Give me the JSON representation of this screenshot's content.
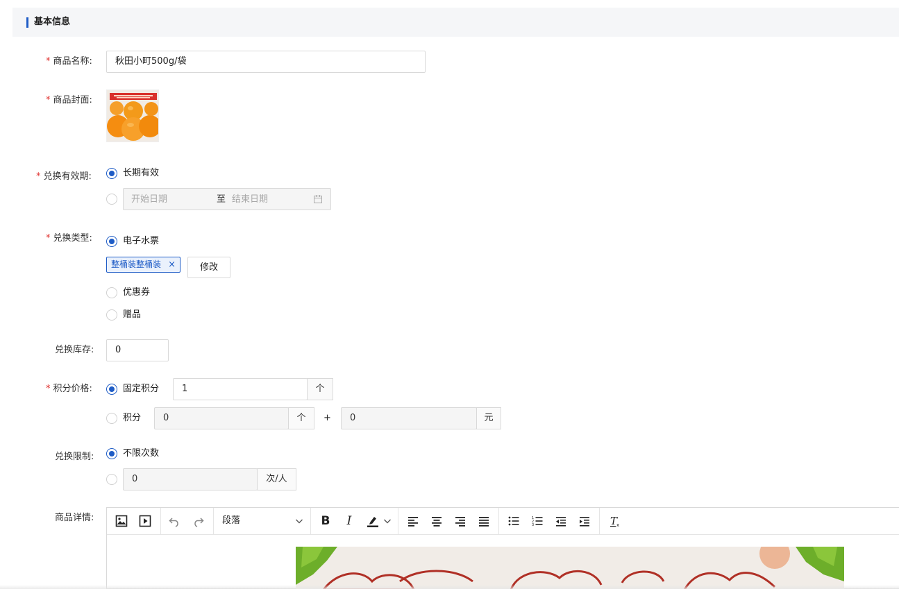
{
  "section": {
    "title": "基本信息"
  },
  "form": {
    "name": {
      "label": "商品名称:",
      "value": "秋田小町500g/袋"
    },
    "cover": {
      "label": "商品封面:",
      "banner_text": "秋田小町500g/袋 柑橘鲜果"
    },
    "validity": {
      "label": "兑换有效期:",
      "option_long": "长期有效",
      "start_placeholder": "开始日期",
      "separator": "至",
      "end_placeholder": "结束日期"
    },
    "type": {
      "label": "兑换类型:",
      "option_ticket": "电子水票",
      "tag": "整桶装整桶装",
      "tag_close": "×",
      "modify_button": "修改",
      "option_coupon": "优惠券",
      "option_gift": "赠品"
    },
    "stock": {
      "label": "兑换库存:",
      "value": "0"
    },
    "price": {
      "label": "积分价格:",
      "option_fixed": "固定积分",
      "fixed_value": "1",
      "fixed_unit": "个",
      "option_mixed": "积分",
      "mixed_points": "0",
      "mixed_points_unit": "个",
      "plus": "+",
      "mixed_money": "0",
      "mixed_money_unit": "元"
    },
    "limit": {
      "label": "兑换限制:",
      "option_unlimited": "不限次数",
      "value": "0",
      "unit": "次/人"
    },
    "detail": {
      "label": "商品详情:",
      "paragraph_select": "段落"
    }
  },
  "colors": {
    "accent": "#1e5cc6",
    "required": "#e0312f"
  }
}
